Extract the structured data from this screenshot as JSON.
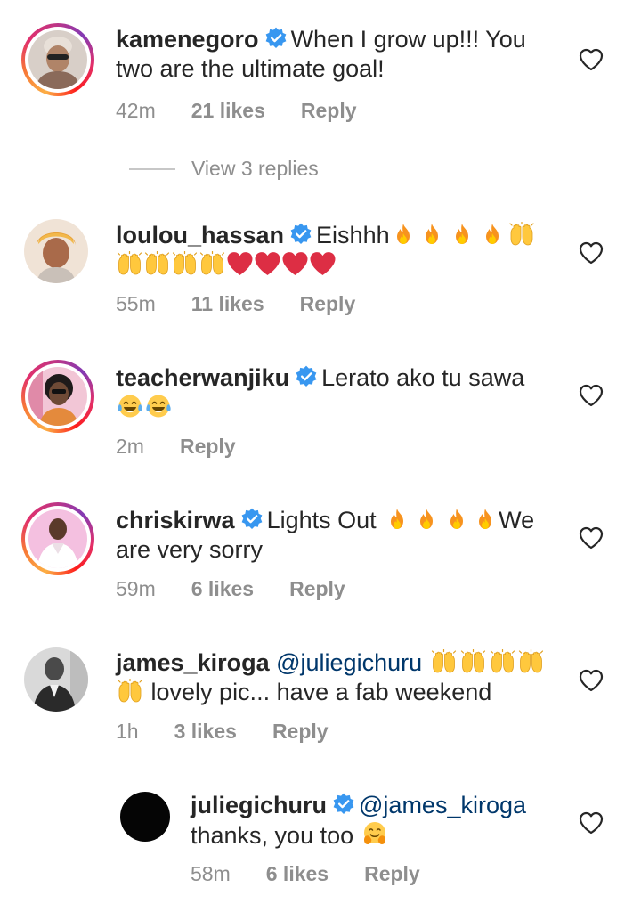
{
  "comments": [
    {
      "username": "kamenegoro",
      "verified": true,
      "text_line1": "When I grow up!!! You",
      "text_line2": "two are the ultimate goal!",
      "time": "42m",
      "likes": "21 likes",
      "reply": "Reply"
    },
    {
      "username": "loulou_hassan",
      "verified": true,
      "text_line1": "Eishhh",
      "emoji_line1": [
        "fire",
        "fire",
        "fire",
        "fire",
        "raising-hands"
      ],
      "emoji_line2": [
        "raising-hands",
        "raising-hands",
        "raising-hands",
        "raising-hands",
        "heart",
        "heart",
        "heart",
        "heart"
      ],
      "time": "55m",
      "likes": "11 likes",
      "reply": "Reply"
    },
    {
      "username": "teacherwanjiku",
      "verified": true,
      "text_line1": "Lerato ako tu sawa",
      "emoji_line2": [
        "tears-of-joy",
        "tears-of-joy"
      ],
      "time": "2m",
      "reply": "Reply"
    },
    {
      "username": "chriskirwa",
      "verified": true,
      "text_line1": "Lights Out",
      "emoji_line1": [
        "fire",
        "fire",
        "fire",
        "fire"
      ],
      "text_line1_end": "We",
      "text_line2": "are very sorry",
      "time": "59m",
      "likes": "6 likes",
      "reply": "Reply"
    },
    {
      "username": "james_kiroga",
      "verified": false,
      "mention": "@juliegichuru",
      "emoji_line1": [
        "raising-hands",
        "raising-hands",
        "raising-hands",
        "raising-hands"
      ],
      "text_line2": "lovely pic... have a fab weekend",
      "time": "1h",
      "likes": "3 likes",
      "reply": "Reply"
    },
    {
      "username": "juliegichuru",
      "verified": true,
      "mention": "@james_kiroga",
      "text_line2": "thanks, you too",
      "emoji_line2": [
        "hugging-face"
      ],
      "time": "58m",
      "likes": "6 likes",
      "reply": "Reply"
    }
  ],
  "view_replies": "View 3 replies",
  "colors": {
    "text": "#262626",
    "meta": "#8e8e8e",
    "mention": "#00376b",
    "verified": "#3897f0"
  }
}
